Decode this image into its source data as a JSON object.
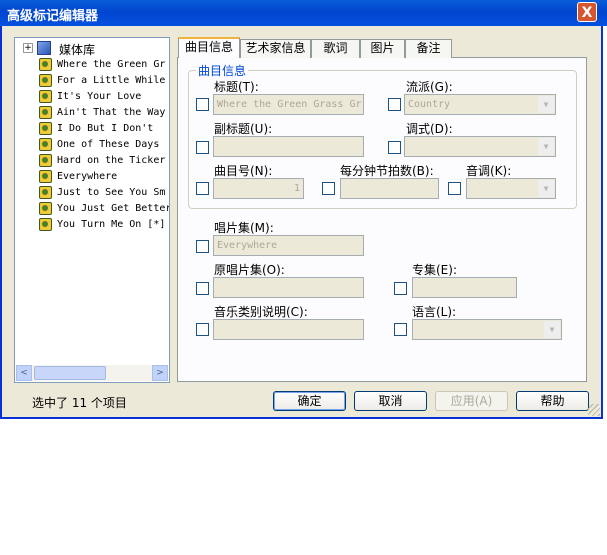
{
  "window": {
    "title": "高级标记编辑器",
    "close_symbol": "X"
  },
  "tree": {
    "root_expander": "+",
    "root_label": "媒体库",
    "items": [
      {
        "label": "Where the Green Gr"
      },
      {
        "label": "For a Little While"
      },
      {
        "label": "It's Your Love"
      },
      {
        "label": "Ain't That the Way"
      },
      {
        "label": "I Do But I Don't"
      },
      {
        "label": "One of These Days"
      },
      {
        "label": "Hard on the Ticker"
      },
      {
        "label": "Everywhere"
      },
      {
        "label": "Just to See You Sm"
      },
      {
        "label": "You Just Get Better"
      },
      {
        "label": "You Turn Me On [*]"
      }
    ],
    "scroll_left": "<",
    "scroll_right": ">"
  },
  "status": {
    "text": "选中了 11 个项目"
  },
  "tabs": [
    {
      "label": "曲目信息",
      "active": true
    },
    {
      "label": "艺术家信息",
      "active": false
    },
    {
      "label": "歌词",
      "active": false
    },
    {
      "label": "图片",
      "active": false
    },
    {
      "label": "备注",
      "active": false
    }
  ],
  "track_group": {
    "legend": "曲目信息",
    "title_label": "标题(T):",
    "title_value": "Where the Green Grass Gr",
    "genre_label": "流派(G):",
    "genre_value": "Country",
    "subtitle_label": "副标题(U):",
    "subtitle_value": "",
    "mood_label": "调式(D):",
    "mood_value": "",
    "track_no_label": "曲目号(N):",
    "track_no_value": "1",
    "bpm_label": "每分钟节拍数(B):",
    "bpm_value": "",
    "key_label": "音调(K):",
    "key_value": ""
  },
  "album_fields": {
    "album_label": "唱片集(M):",
    "album_value": "Everywhere",
    "orig_album_label": "原唱片集(O):",
    "orig_album_value": "",
    "set_label": "专集(E):",
    "set_value": "",
    "content_label": "音乐类别说明(C):",
    "content_value": "",
    "language_label": "语言(L):",
    "language_value": ""
  },
  "buttons": {
    "ok": "确定",
    "cancel": "取消",
    "apply": "应用(A)",
    "help": "帮助"
  },
  "combo_arrow": "▼",
  "colors": {
    "titlebar": "#0045cf",
    "group_legend": "#0046d5",
    "active_tab_accent": "#f0b33c"
  }
}
